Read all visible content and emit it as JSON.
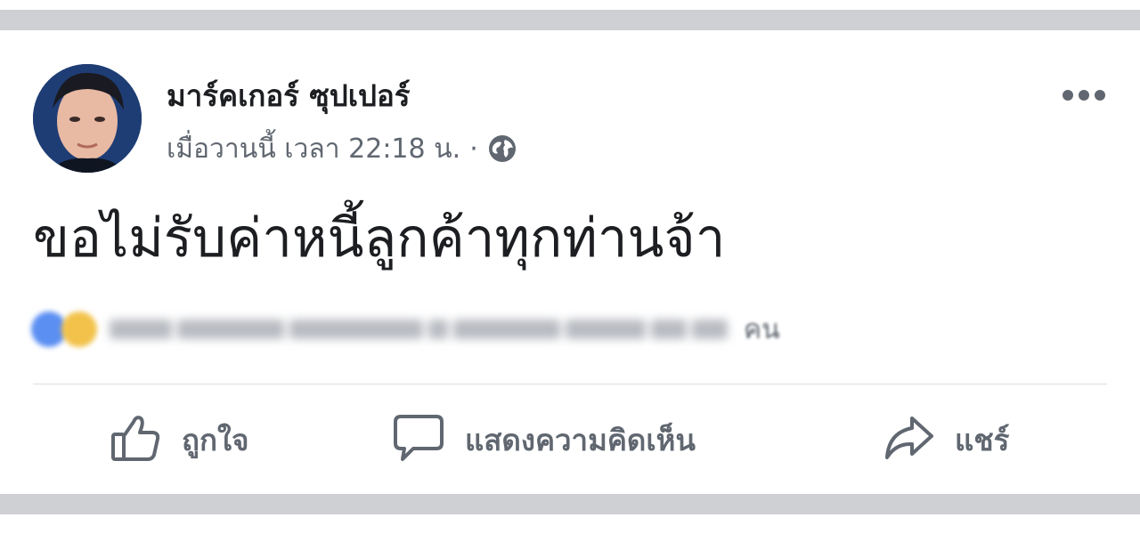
{
  "post": {
    "author_name": "มาร์คเกอร์ ซุปเปอร์",
    "timestamp": "เมื่อวานนี้ เวลา 22:18 น.",
    "separator": "·",
    "privacy_icon": "globe-icon",
    "more_icon": "more-horizontal-icon",
    "text": "ขอไม่รับค่าหนี้ลูกค้าทุกท่านจ้า"
  },
  "reactions": {
    "icons": [
      "like-reaction-icon",
      "love-reaction-icon"
    ],
    "summary_blurred": true,
    "count_suffix": "คน"
  },
  "actions": {
    "like_label": "ถูกใจ",
    "comment_label": "แสดงความคิดเห็น",
    "share_label": "แชร์"
  },
  "colors": {
    "divider": "#ced0d4",
    "text_primary": "#1c1e21",
    "text_secondary": "#606770"
  }
}
